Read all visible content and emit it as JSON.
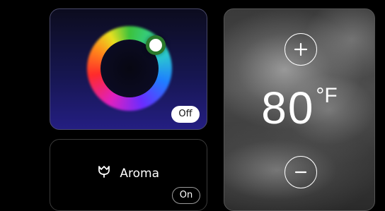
{
  "light": {
    "toggle_label": "Off"
  },
  "aroma": {
    "label": "Aroma",
    "icon": "tulip-icon",
    "toggle_label": "On"
  },
  "temperature": {
    "value": "80",
    "unit": "°F",
    "increase_icon": "plus-icon",
    "decrease_icon": "minus-icon"
  }
}
